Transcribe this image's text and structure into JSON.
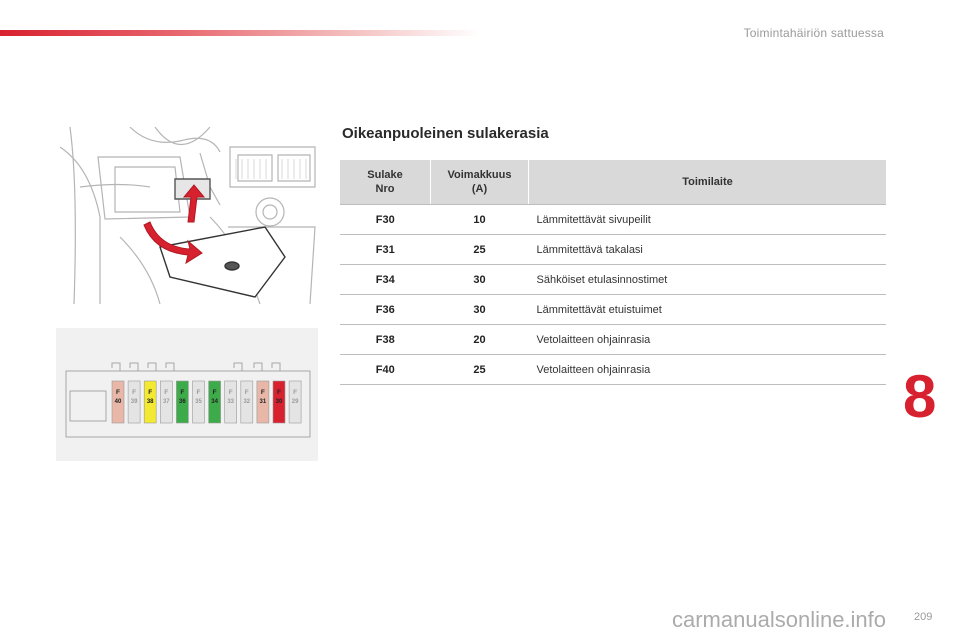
{
  "header": {
    "title": "Toimintahäiriön sattuessa"
  },
  "section": {
    "title": "Oikeanpuoleinen sulakerasia"
  },
  "table": {
    "columns": [
      {
        "line1": "Sulake",
        "line2": "Nro"
      },
      {
        "line1": "Voimakkuus",
        "line2": "(A)"
      },
      {
        "line1": "Toimilaite",
        "line2": ""
      }
    ],
    "rows": [
      {
        "fuse": "F30",
        "amp": "10",
        "function": "Lämmitettävät sivupeilit"
      },
      {
        "fuse": "F31",
        "amp": "25",
        "function": "Lämmitettävä takalasi"
      },
      {
        "fuse": "F34",
        "amp": "30",
        "function": "Sähköiset etulasinnostimet"
      },
      {
        "fuse": "F36",
        "amp": "30",
        "function": "Lämmitettävät etuistuimet"
      },
      {
        "fuse": "F38",
        "amp": "20",
        "function": "Vetolaitteen ohjainrasia"
      },
      {
        "fuse": "F40",
        "amp": "25",
        "function": "Vetolaitteen ohjainrasia"
      }
    ]
  },
  "fuse_box": {
    "fuses": [
      {
        "letter": "F",
        "num": "40",
        "color": "#e8b7a8",
        "active": true
      },
      {
        "letter": "F",
        "num": "39",
        "color": "#e4e4e4",
        "active": false
      },
      {
        "letter": "F",
        "num": "38",
        "color": "#f3e832",
        "active": true
      },
      {
        "letter": "F",
        "num": "37",
        "color": "#e4e4e4",
        "active": false
      },
      {
        "letter": "F",
        "num": "36",
        "color": "#3dab4a",
        "active": true
      },
      {
        "letter": "F",
        "num": "35",
        "color": "#e4e4e4",
        "active": false
      },
      {
        "letter": "F",
        "num": "34",
        "color": "#3dab4a",
        "active": true
      },
      {
        "letter": "F",
        "num": "33",
        "color": "#e4e4e4",
        "active": false
      },
      {
        "letter": "F",
        "num": "32",
        "color": "#e4e4e4",
        "active": false
      },
      {
        "letter": "F",
        "num": "31",
        "color": "#e8b7a8",
        "active": true
      },
      {
        "letter": "F",
        "num": "30",
        "color": "#d8212f",
        "active": true
      },
      {
        "letter": "F",
        "num": "29",
        "color": "#e4e4e4",
        "active": false
      }
    ]
  },
  "chapter": {
    "number": "8"
  },
  "page": {
    "number": "209"
  },
  "footer": {
    "watermark": "carmanualsonline.info"
  },
  "colors": {
    "accent": "#d8212f",
    "table_header": "#d9d9d9"
  }
}
